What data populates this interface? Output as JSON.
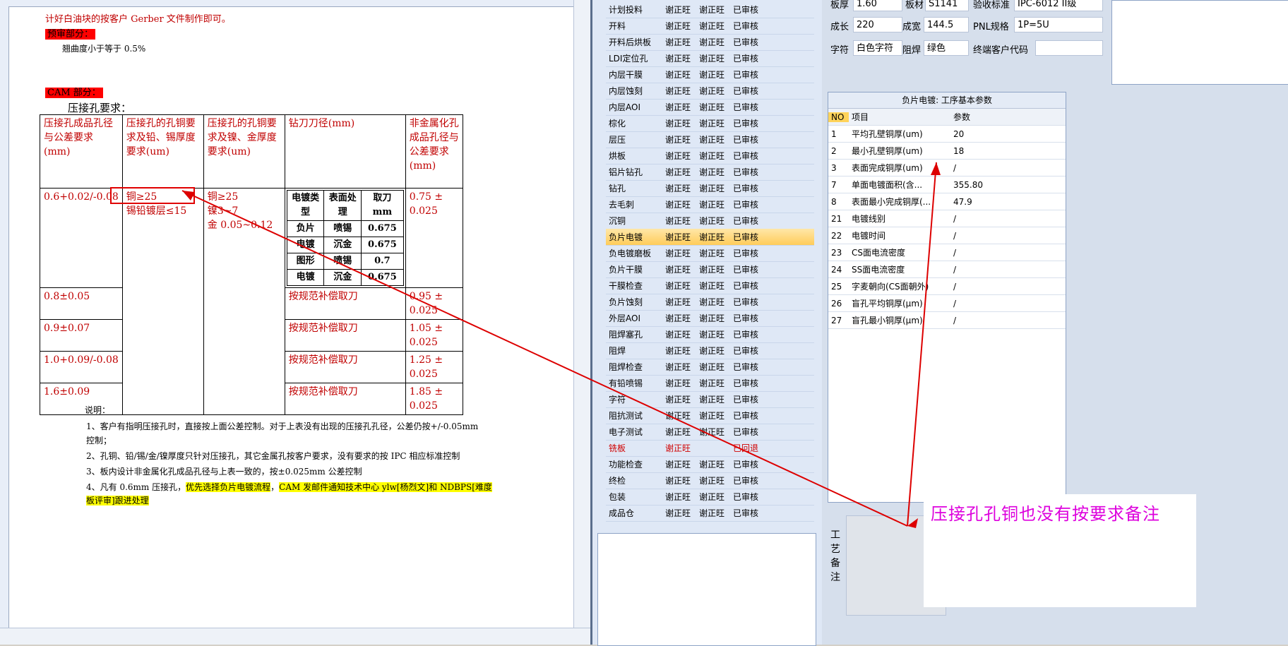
{
  "document": {
    "line1": "计好白油块的按客户 Gerber 文件制作即可。",
    "pre_review_label": "预审部分：",
    "warp_text": "翘曲度小于等于 0.5%",
    "cam_label": "CAM 部分：",
    "press_fit_title": "压接孔要求：",
    "table_headers": [
      "压接孔成品孔径与公差要求(mm)",
      "压接孔的孔铜要求及铅、锡厚度要求(um)",
      "压接孔的孔铜要求及镍、金厚度要求(um)",
      "钻刀刀径(mm)",
      "非金属化孔成品孔径与公差要求(mm)"
    ],
    "row1_col1": "0.6+0.02/-0.08",
    "row1_col2_a": "铜≥25",
    "row1_col2_b": "锡铅镀层≤15",
    "row1_col3_a": "铜≥25",
    "row1_col3_b": "镍3~7",
    "row1_col3_c": "金 0.05~0.12",
    "inner_headers": [
      "电镀类型",
      "表面处理",
      "取刀mm"
    ],
    "inner_rows": [
      [
        "负片",
        "喷锡",
        "0.675"
      ],
      [
        "电镀",
        "沉金",
        "0.675"
      ],
      [
        "图形",
        "喷锡",
        "0.7"
      ],
      [
        "电镀",
        "沉金",
        "0.675"
      ]
    ],
    "row1_col5": "0.75 ± 0.025",
    "rows": [
      {
        "col1": "0.8±0.05",
        "col4": "按规范补偿取刀",
        "col5": "0.95 ± 0.025"
      },
      {
        "col1": "0.9±0.07",
        "col4": "按规范补偿取刀",
        "col5": "1.05 ± 0.025"
      },
      {
        "col1": "1.0+0.09/-0.08",
        "col4": "按规范补偿取刀",
        "col5": "1.25 ± 0.025"
      },
      {
        "col1": "1.6±0.09",
        "col4": "按规范补偿取刀",
        "col5": "1.85 ± 0.025"
      }
    ],
    "notes_title": "说明：",
    "note1a": "1、客户有指明压接孔时，直接按上面公差控制。对于上表没有出现的压接孔孔径，公差仍按+/-0.05mm",
    "note1b": "控制；",
    "note2": "2、孔铜、铅/锡/金/镍厚度只针对压接孔，其它金属孔按客户要求，没有要求的按 IPC 相应标准控制",
    "note3": "3、板内设计非金属化孔成品孔径与上表一致的，按±0.025mm 公差控制",
    "note4_prefix": "4、凡有 0.6mm 压接孔，",
    "note4_hl1": "优先选择负片电镀流程",
    "note4_sep": "，",
    "note4_hl2": "CAM 发邮件通知技术中心 ylw[杨烈文]和 NDBPS[难度",
    "note4_hl3": "板评审]跟进处理"
  },
  "process_list": [
    [
      "计划投料",
      "谢正旺",
      "谢正旺",
      "已审核"
    ],
    [
      "开料",
      "谢正旺",
      "谢正旺",
      "已审核"
    ],
    [
      "开料后烘板",
      "谢正旺",
      "谢正旺",
      "已审核"
    ],
    [
      "LDI定位孔",
      "谢正旺",
      "谢正旺",
      "已审核"
    ],
    [
      "内层干膜",
      "谢正旺",
      "谢正旺",
      "已审核"
    ],
    [
      "内层蚀刻",
      "谢正旺",
      "谢正旺",
      "已审核"
    ],
    [
      "内层AOI",
      "谢正旺",
      "谢正旺",
      "已审核"
    ],
    [
      "棕化",
      "谢正旺",
      "谢正旺",
      "已审核"
    ],
    [
      "层压",
      "谢正旺",
      "谢正旺",
      "已审核"
    ],
    [
      "烘板",
      "谢正旺",
      "谢正旺",
      "已审核"
    ],
    [
      "铝片钻孔",
      "谢正旺",
      "谢正旺",
      "已审核"
    ],
    [
      "钻孔",
      "谢正旺",
      "谢正旺",
      "已审核"
    ],
    [
      "去毛刺",
      "谢正旺",
      "谢正旺",
      "已审核"
    ],
    [
      "沉铜",
      "谢正旺",
      "谢正旺",
      "已审核"
    ],
    [
      "负片电镀",
      "谢正旺",
      "谢正旺",
      "已审核"
    ],
    [
      "负电镀磨板",
      "谢正旺",
      "谢正旺",
      "已审核"
    ],
    [
      "负片干膜",
      "谢正旺",
      "谢正旺",
      "已审核"
    ],
    [
      "干膜检查",
      "谢正旺",
      "谢正旺",
      "已审核"
    ],
    [
      "负片蚀刻",
      "谢正旺",
      "谢正旺",
      "已审核"
    ],
    [
      "外层AOI",
      "谢正旺",
      "谢正旺",
      "已审核"
    ],
    [
      "阻焊塞孔",
      "谢正旺",
      "谢正旺",
      "已审核"
    ],
    [
      "阻焊",
      "谢正旺",
      "谢正旺",
      "已审核"
    ],
    [
      "阻焊检查",
      "谢正旺",
      "谢正旺",
      "已审核"
    ],
    [
      "有铅喷锡",
      "谢正旺",
      "谢正旺",
      "已审核"
    ],
    [
      "字符",
      "谢正旺",
      "谢正旺",
      "已审核"
    ],
    [
      "阻抗测试",
      "谢正旺",
      "谢正旺",
      "已审核"
    ],
    [
      "电子测试",
      "谢正旺",
      "谢正旺",
      "已审核"
    ],
    [
      "铣板",
      "谢正旺",
      "",
      "已回退"
    ],
    [
      "功能检查",
      "谢正旺",
      "谢正旺",
      "已审核"
    ],
    [
      "终检",
      "谢正旺",
      "谢正旺",
      "已审核"
    ],
    [
      "包装",
      "谢正旺",
      "谢正旺",
      "已审核"
    ],
    [
      "成品仓",
      "谢正旺",
      "谢正旺",
      "已审核"
    ]
  ],
  "board_info": {
    "thickness_label": "板厚",
    "thickness": "1.60",
    "material_label": "板材",
    "material": "S1141",
    "standard_label": "验收标准",
    "standard": "IPC-6012 II级",
    "length_label": "成长",
    "length": "220",
    "width_label": "成宽",
    "width": "144.5",
    "pnl_label": "PNL规格",
    "pnl": "1P=5U",
    "char_label": "字符",
    "char": "白色字符",
    "mask_label": "阻焊",
    "mask": "绿色",
    "end_customer_label": "终端客户代码",
    "end_customer": ""
  },
  "params": {
    "title": "负片电镀: 工序基本参数",
    "head_no": "NO",
    "head_item": "项目",
    "head_value": "参数",
    "rows": [
      [
        "1",
        "平均孔壁铜厚(um)",
        "20"
      ],
      [
        "2",
        "最小孔壁铜厚(um)",
        "18"
      ],
      [
        "3",
        "表面完成铜厚(um)",
        "/"
      ],
      [
        "7",
        "单面电镀面积(含...",
        "355.80"
      ],
      [
        "8",
        "表面最小完成铜厚(...",
        "47.9"
      ],
      [
        "21",
        "电镀线别",
        "/"
      ],
      [
        "22",
        "电镀时间",
        "/"
      ],
      [
        "23",
        "CS面电流密度",
        "/"
      ],
      [
        "24",
        "SS面电流密度",
        "/"
      ],
      [
        "25",
        "字麦朝向(CS面朝外)",
        "/"
      ],
      [
        "26",
        "盲孔平均铜厚(μm)",
        "/"
      ],
      [
        "27",
        "盲孔最小铜厚(μm)",
        "/"
      ]
    ]
  },
  "craft_note_label": "工艺备注",
  "annotation": "压接孔孔铜也没有按要求备注",
  "colors": {
    "annotation": "#dd00dd",
    "arrow": "#dd0000",
    "selected_row": "#ffcc5a"
  }
}
